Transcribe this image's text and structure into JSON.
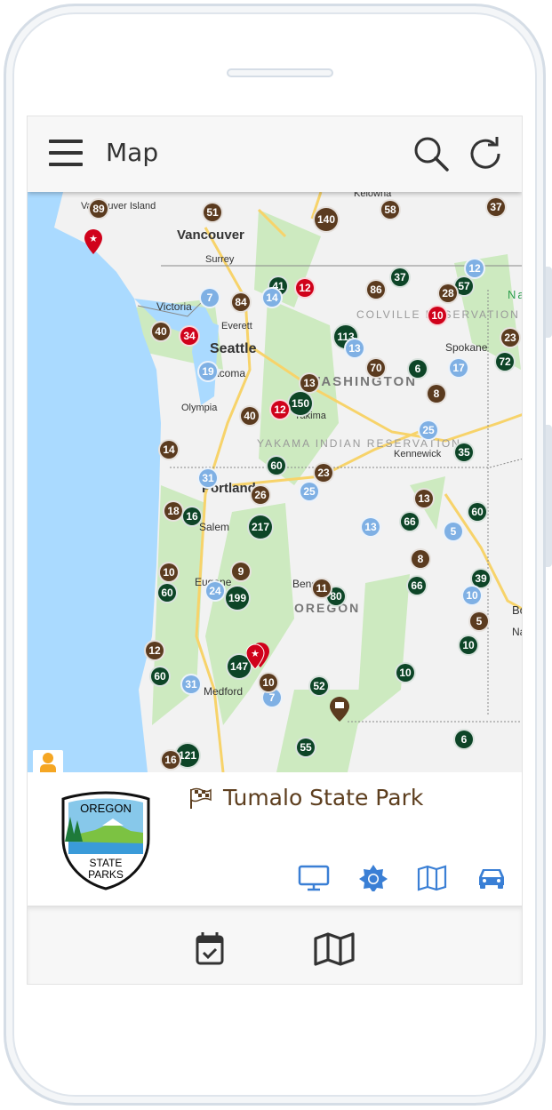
{
  "header": {
    "title": "Map",
    "menu_icon": "hamburger-icon",
    "search_icon": "search-icon",
    "refresh_icon": "refresh-icon"
  },
  "map": {
    "labels": {
      "vancouver_island": "Vancouver Island",
      "vancouver": "Vancouver",
      "surrey": "Surrey",
      "victoria": "Victoria",
      "everett": "Everett",
      "seattle": "Seattle",
      "tacoma": "Tacoma",
      "olympia": "Olympia",
      "kelowna": "Kelowna",
      "colville": "COLVILLE RESERVATION",
      "washington": "WASHINGTON",
      "spokane": "Spokane",
      "yakima": "Yakima",
      "yakama": "YAKAMA INDIAN RESERVATION",
      "kennewick": "Kennewick",
      "portland": "Portland",
      "salem": "Salem",
      "eugene": "Eugene",
      "bend": "Bend",
      "oregon": "OREGON",
      "medford": "Medford",
      "nampa": "Nampa",
      "boise": "Bo",
      "na": "Na"
    },
    "colors": {
      "brown": "#5b3b1f",
      "green": "#0d4527",
      "blue": "#7fb0e4",
      "red": "#d0021b",
      "water": "#aadaff",
      "land": "#f2f2f2",
      "park": "#cdeac0"
    },
    "clusters": [
      {
        "count": "89",
        "type": "brown"
      },
      {
        "count": "51",
        "type": "brown"
      },
      {
        "count": "140",
        "type": "brown"
      },
      {
        "count": "58",
        "type": "brown"
      },
      {
        "count": "37",
        "type": "brown"
      },
      {
        "count": "37",
        "type": "green"
      },
      {
        "count": "12",
        "type": "blue"
      },
      {
        "count": "57",
        "type": "green"
      },
      {
        "count": "28",
        "type": "brown"
      },
      {
        "count": "86",
        "type": "brown"
      },
      {
        "count": "41",
        "type": "green"
      },
      {
        "count": "14",
        "type": "blue"
      },
      {
        "count": "12",
        "type": "red"
      },
      {
        "count": "7",
        "type": "blue"
      },
      {
        "count": "84",
        "type": "brown"
      },
      {
        "count": "40",
        "type": "brown"
      },
      {
        "count": "34",
        "type": "red"
      },
      {
        "count": "10",
        "type": "red"
      },
      {
        "count": "23",
        "type": "brown"
      },
      {
        "count": "113",
        "type": "green"
      },
      {
        "count": "13",
        "type": "blue"
      },
      {
        "count": "19",
        "type": "blue"
      },
      {
        "count": "70",
        "type": "brown"
      },
      {
        "count": "6",
        "type": "green"
      },
      {
        "count": "17",
        "type": "blue"
      },
      {
        "count": "72",
        "type": "green"
      },
      {
        "count": "13",
        "type": "brown"
      },
      {
        "count": "8",
        "type": "brown"
      },
      {
        "count": "150",
        "type": "green"
      },
      {
        "count": "12",
        "type": "red"
      },
      {
        "count": "40",
        "type": "brown"
      },
      {
        "count": "25",
        "type": "blue"
      },
      {
        "count": "14",
        "type": "brown"
      },
      {
        "count": "35",
        "type": "green"
      },
      {
        "count": "60",
        "type": "green"
      },
      {
        "count": "23",
        "type": "brown"
      },
      {
        "count": "31",
        "type": "blue"
      },
      {
        "count": "26",
        "type": "brown"
      },
      {
        "count": "25",
        "type": "blue"
      },
      {
        "count": "13",
        "type": "brown"
      },
      {
        "count": "18",
        "type": "brown"
      },
      {
        "count": "16",
        "type": "green"
      },
      {
        "count": "217",
        "type": "green"
      },
      {
        "count": "13",
        "type": "blue"
      },
      {
        "count": "66",
        "type": "green"
      },
      {
        "count": "5",
        "type": "blue"
      },
      {
        "count": "60",
        "type": "green"
      },
      {
        "count": "8",
        "type": "brown"
      },
      {
        "count": "9",
        "type": "brown"
      },
      {
        "count": "10",
        "type": "brown"
      },
      {
        "count": "60",
        "type": "green"
      },
      {
        "count": "24",
        "type": "blue"
      },
      {
        "count": "199",
        "type": "green"
      },
      {
        "count": "80",
        "type": "green"
      },
      {
        "count": "11",
        "type": "brown"
      },
      {
        "count": "66",
        "type": "green"
      },
      {
        "count": "39",
        "type": "green"
      },
      {
        "count": "10",
        "type": "blue"
      },
      {
        "count": "5",
        "type": "brown"
      },
      {
        "count": "12",
        "type": "brown"
      },
      {
        "count": "147",
        "type": "green"
      },
      {
        "count": "60",
        "type": "green"
      },
      {
        "count": "31",
        "type": "blue"
      },
      {
        "count": "7",
        "type": "blue"
      },
      {
        "count": "10",
        "type": "brown"
      },
      {
        "count": "52",
        "type": "green"
      },
      {
        "count": "10",
        "type": "green"
      },
      {
        "count": "10",
        "type": "green"
      },
      {
        "count": "55",
        "type": "green"
      },
      {
        "count": "6",
        "type": "green"
      },
      {
        "count": "121",
        "type": "green"
      },
      {
        "count": "16",
        "type": "brown"
      }
    ],
    "pegman_icon": "street-view-pegman-icon"
  },
  "card": {
    "park_name": "Tumalo State Park",
    "park_icon": "checkered-flag-icon",
    "logo": {
      "top": "OREGON",
      "bottom1": "STATE",
      "bottom2": "PARKS"
    },
    "actions": [
      {
        "icon": "monitor-icon"
      },
      {
        "icon": "sun-icon"
      },
      {
        "icon": "map-icon"
      },
      {
        "icon": "car-icon"
      }
    ]
  },
  "bottom_nav": [
    {
      "icon": "calendar-check-icon"
    },
    {
      "icon": "map-icon"
    }
  ]
}
